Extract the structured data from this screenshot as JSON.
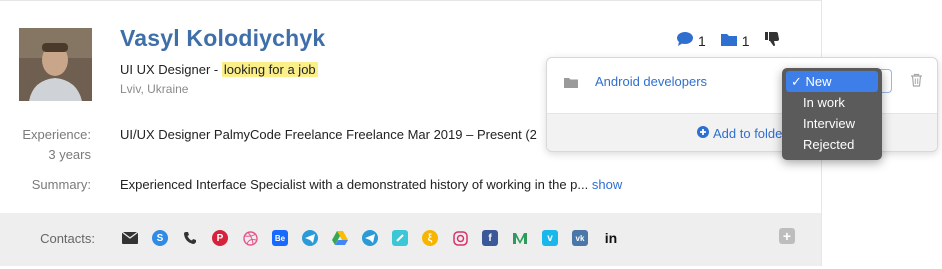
{
  "profile": {
    "name": "Vasyl Kolodiychyk",
    "role": "UI UX Designer -",
    "status_highlight": "looking for a job",
    "location": "Lviv, Ukraine"
  },
  "experience": {
    "label": "Experience:",
    "years": "3 years",
    "value": "UI/UX Designer PalmyCode Freelance Freelance Mar 2019 – Present (2"
  },
  "summary": {
    "label": "Summary:",
    "value": "Experienced Interface Specialist with a demonstrated history of working in the p...",
    "show_link": "show"
  },
  "actions": {
    "comments_count": "1",
    "folders_count": "1"
  },
  "folder_popover": {
    "folder_name": "Android developers",
    "add_label": "Add to folde"
  },
  "status_dropdown": {
    "options": [
      "New",
      "In work",
      "Interview",
      "Rejected"
    ],
    "selected_mark": "✓"
  },
  "contacts": {
    "label": "Contacts:",
    "icons": [
      "email-icon",
      "skype-icon",
      "phone-icon",
      "pinterest-icon",
      "dribbble-icon",
      "behance-icon",
      "telegram-icon",
      "google-drive-icon",
      "telegram-icon",
      "site-icon",
      "coin-icon",
      "instagram-icon",
      "facebook-icon",
      "medium-icon",
      "vimeo-icon",
      "vk-icon",
      "linkedin-icon"
    ],
    "linkedin_text": "in",
    "behance_text": "Be"
  },
  "colors": {
    "accent": "#2f6fd0",
    "name": "#3f6fa8",
    "highlight": "#fbef8a",
    "dropdown_bg": "#5b5b5b",
    "dropdown_sel": "#3d7ee8"
  }
}
